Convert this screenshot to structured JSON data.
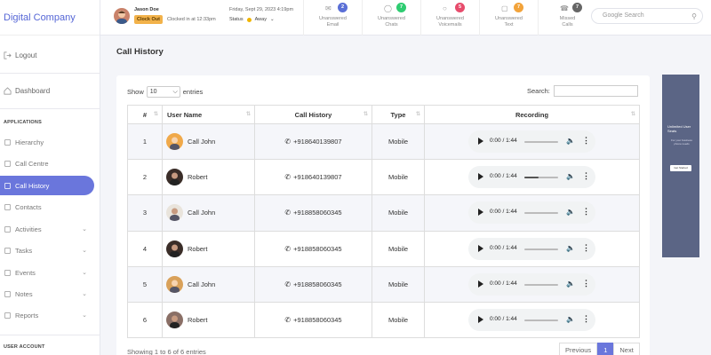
{
  "sidebar": {
    "brand": "Digital Company",
    "logout": "Logout",
    "dashboard": "Dashboard",
    "applications_label": "APPLICATIONS",
    "items": [
      {
        "label": "Hierarchy",
        "icon": "hierarchy-icon",
        "chevron": false
      },
      {
        "label": "Call Centre",
        "icon": "headset-icon",
        "chevron": false
      },
      {
        "label": "Call History",
        "icon": "call-history-icon",
        "chevron": false,
        "active": true
      },
      {
        "label": "Contacts",
        "icon": "contacts-icon",
        "chevron": false
      },
      {
        "label": "Activities",
        "icon": "activity-icon",
        "chevron": true
      },
      {
        "label": "Tasks",
        "icon": "tasks-icon",
        "chevron": true
      },
      {
        "label": "Events",
        "icon": "calendar-icon",
        "chevron": true
      },
      {
        "label": "Notes",
        "icon": "notes-icon",
        "chevron": true
      },
      {
        "label": "Reports",
        "icon": "reports-icon",
        "chevron": true
      }
    ],
    "user_account_label": "USER ACCOUNT"
  },
  "topbar": {
    "user_name": "Jason Doe",
    "clock_out": "Clock Out",
    "clocked_in": "Clocked in at 12:33pm",
    "datetime": "Friday, Sept 29, 2023 4:19pm",
    "status_label": "Status",
    "status_value": "Away",
    "notifications": [
      {
        "count": "2",
        "label1": "Unanswered",
        "label2": "Email",
        "color": "#5a6fd6",
        "icon": "mail-icon"
      },
      {
        "count": "7",
        "label1": "Unanswered",
        "label2": "Chats",
        "color": "#2ecc71",
        "icon": "chat-icon"
      },
      {
        "count": "5",
        "label1": "Unanswered",
        "label2": "Voicemails",
        "color": "#e74c6c",
        "icon": "voicemail-icon"
      },
      {
        "count": "7",
        "label1": "Unanswered",
        "label2": "Text",
        "color": "#f2a33a",
        "icon": "text-icon"
      },
      {
        "count": "7",
        "label1": "Missed",
        "label2": "Calls",
        "color": "#666666",
        "icon": "missed-call-icon"
      }
    ],
    "search_placeholder": "Google Search"
  },
  "main": {
    "title": "Call History",
    "show_label": "Show",
    "entries_value": "10",
    "entries_label": "entries",
    "search_label": "Search:",
    "columns": [
      "#",
      "User Name",
      "Call History",
      "Type",
      "Recording"
    ],
    "rows": [
      {
        "num": "1",
        "name": "Call John",
        "phone": "+918640139807",
        "type": "Mobile",
        "time": "0:00 / 1:44",
        "progress": 0,
        "avatar": "#f0a94a"
      },
      {
        "num": "2",
        "name": "Robert",
        "phone": "+918640139807",
        "type": "Mobile",
        "time": "0:00 / 1:44",
        "progress": 0.42,
        "avatar": "#3a2d28"
      },
      {
        "num": "3",
        "name": "Call John",
        "phone": "+918858060345",
        "type": "Mobile",
        "time": "0:00 / 1:44",
        "progress": 0,
        "avatar": "#e9e4dc"
      },
      {
        "num": "4",
        "name": "Robert",
        "phone": "+918858060345",
        "type": "Mobile",
        "time": "0:00 / 1:44",
        "progress": 0,
        "avatar": "#3a2d28"
      },
      {
        "num": "5",
        "name": "Call John",
        "phone": "+918858060345",
        "type": "Mobile",
        "time": "0:00 / 1:44",
        "progress": 0,
        "avatar": "#d9a15a"
      },
      {
        "num": "6",
        "name": "Robert",
        "phone": "+918858060345",
        "type": "Mobile",
        "time": "0:00 / 1:44",
        "progress": 0,
        "avatar": "#8a6f66"
      }
    ],
    "footer_info": "Showing 1 to 6 of 6 entries",
    "pager": {
      "prev": "Previous",
      "current": "1",
      "next": "Next"
    }
  },
  "ad": {
    "headline": "Unlimited User Seats",
    "body": "For your business phone needs",
    "button": "Get Started"
  }
}
